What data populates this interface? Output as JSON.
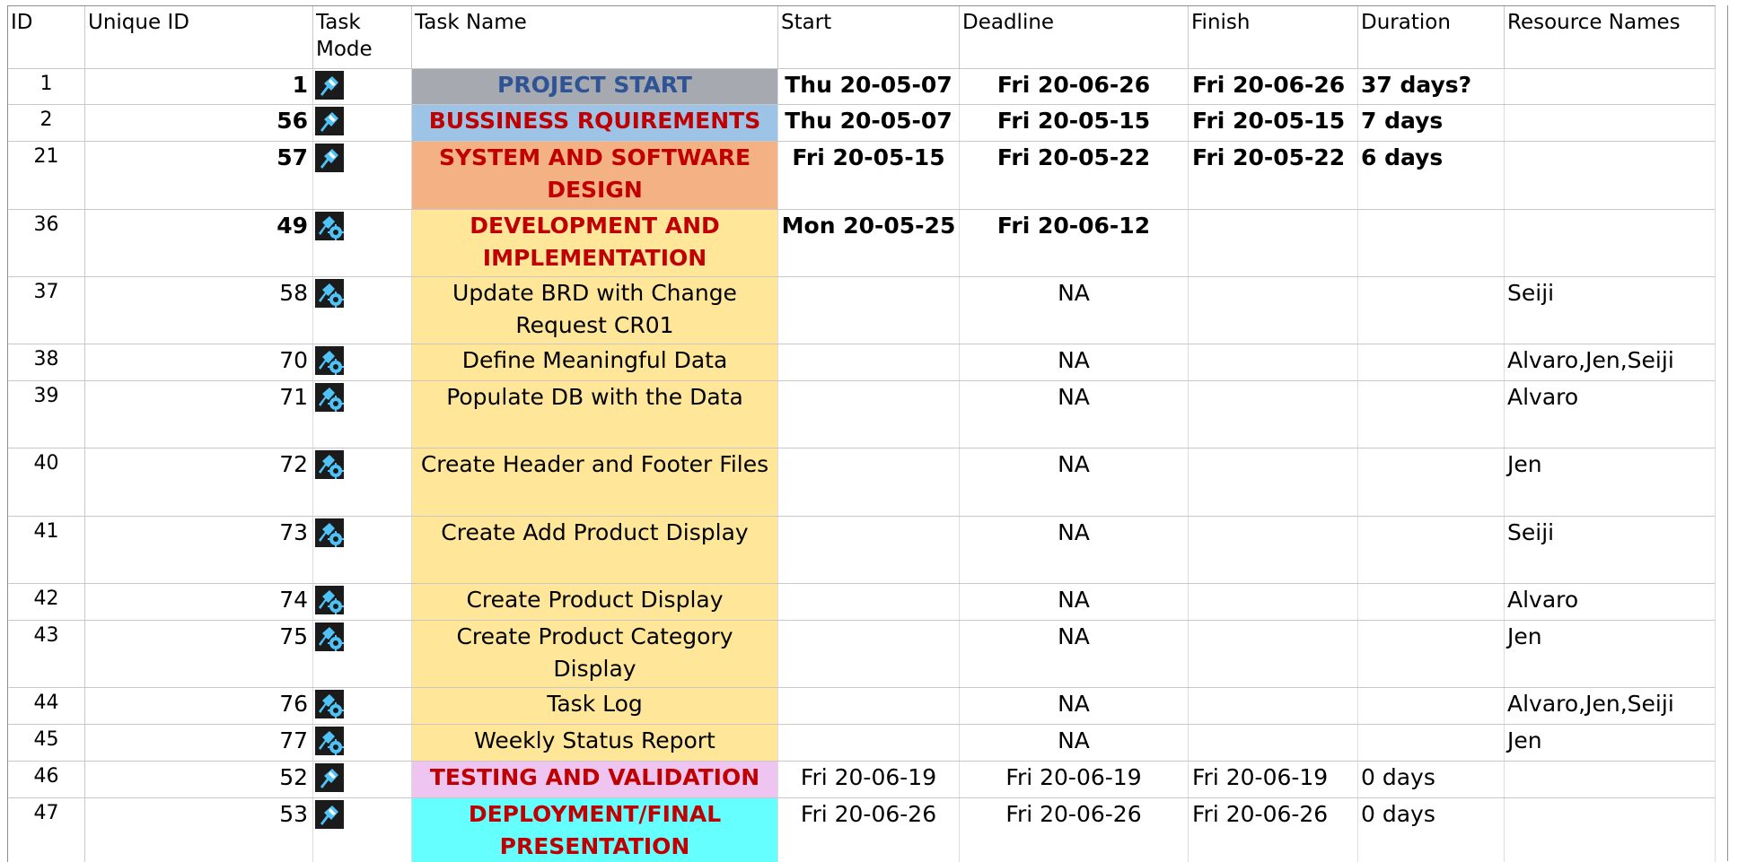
{
  "headers": {
    "id": "ID",
    "unique_id": "Unique ID",
    "task_mode": "Task Mode",
    "task_name": "Task Name",
    "start": "Start",
    "deadline": "Deadline",
    "finish": "Finish",
    "duration": "Duration",
    "resource_names": "Resource Names"
  },
  "rows": [
    {
      "id": "1",
      "uid": "1",
      "mode": "manual-pin-icon",
      "name": "PROJECT START",
      "start": "Thu 20-05-07",
      "deadline": "Fri 20-06-26",
      "finish": "Fri 20-06-26",
      "duration": "37 days?",
      "resources": "",
      "fill": "#a6a9b0",
      "name_style": "blue",
      "bold": true
    },
    {
      "id": "2",
      "uid": "56",
      "mode": "manual-pin-icon",
      "name": "BUSSINESS RQUIREMENTS",
      "start": "Thu 20-05-07",
      "deadline": "Fri 20-05-15",
      "finish": "Fri 20-05-15",
      "duration": "7 days",
      "resources": "",
      "fill": "#9dc3e6",
      "name_style": "red",
      "bold": true
    },
    {
      "id": "21",
      "uid": "57",
      "mode": "manual-pin-icon",
      "name": "SYSTEM AND SOFTWARE DESIGN",
      "start": "Fri 20-05-15",
      "deadline": "Fri 20-05-22",
      "finish": "Fri 20-05-22",
      "duration": "6 days",
      "resources": "",
      "fill": "#f4b183",
      "name_style": "red",
      "bold": true
    },
    {
      "id": "36",
      "uid": "49",
      "mode": "auto-pin-icon",
      "name": "DEVELOPMENT AND IMPLEMENTATION",
      "start": "Mon 20-05-25",
      "deadline": "Fri 20-06-12",
      "finish": "",
      "duration": "",
      "resources": "",
      "fill": "#ffe699",
      "name_style": "red",
      "bold": true
    },
    {
      "id": "37",
      "uid": "58",
      "mode": "auto-pin-icon",
      "name": "Update BRD with Change Request CR01",
      "start": "",
      "deadline": "NA",
      "finish": "",
      "duration": "",
      "resources": "Seiji",
      "fill": "#ffe699",
      "name_style": "normal",
      "bold": false
    },
    {
      "id": "38",
      "uid": "70",
      "mode": "auto-pin-icon",
      "name": "Define Meaningful Data",
      "start": "",
      "deadline": "NA",
      "finish": "",
      "duration": "",
      "resources": "Alvaro,Jen,Seiji",
      "fill": "#ffe699",
      "name_style": "normal",
      "bold": false
    },
    {
      "id": "39",
      "uid": "71",
      "mode": "auto-pin-icon",
      "name": "Populate DB with the Data",
      "start": "",
      "deadline": "NA",
      "finish": "",
      "duration": "",
      "resources": "Alvaro",
      "fill": "#ffe699",
      "name_style": "normal",
      "bold": false
    },
    {
      "id": "40",
      "uid": "72",
      "mode": "auto-pin-icon",
      "name": "Create Header and Footer Files",
      "start": "",
      "deadline": "NA",
      "finish": "",
      "duration": "",
      "resources": "Jen",
      "fill": "#ffe699",
      "name_style": "normal",
      "bold": false
    },
    {
      "id": "41",
      "uid": "73",
      "mode": "auto-pin-icon",
      "name": "Create Add Product Display",
      "start": "",
      "deadline": "NA",
      "finish": "",
      "duration": "",
      "resources": "Seiji",
      "fill": "#ffe699",
      "name_style": "normal",
      "bold": false
    },
    {
      "id": "42",
      "uid": "74",
      "mode": "auto-pin-icon",
      "name": "Create Product Display",
      "start": "",
      "deadline": "NA",
      "finish": "",
      "duration": "",
      "resources": "Alvaro",
      "fill": "#ffe699",
      "name_style": "normal",
      "bold": false
    },
    {
      "id": "43",
      "uid": "75",
      "mode": "auto-pin-icon",
      "name": "Create Product Category Display",
      "start": "",
      "deadline": "NA",
      "finish": "",
      "duration": "",
      "resources": "Jen",
      "fill": "#ffe699",
      "name_style": "normal",
      "bold": false
    },
    {
      "id": "44",
      "uid": "76",
      "mode": "auto-pin-icon",
      "name": "Task Log",
      "start": "",
      "deadline": "NA",
      "finish": "",
      "duration": "",
      "resources": "Alvaro,Jen,Seiji",
      "fill": "#ffe699",
      "name_style": "normal",
      "bold": false
    },
    {
      "id": "45",
      "uid": "77",
      "mode": "auto-pin-icon",
      "name": "Weekly Status Report",
      "start": "",
      "deadline": "NA",
      "finish": "",
      "duration": "",
      "resources": "Jen",
      "fill": "#ffe699",
      "name_style": "normal",
      "bold": false
    },
    {
      "id": "46",
      "uid": "52",
      "mode": "manual-pin-icon",
      "name": "TESTING AND VALIDATION",
      "start": "Fri 20-06-19",
      "deadline": "Fri 20-06-19",
      "finish": "Fri 20-06-19",
      "duration": "0 days",
      "resources": "",
      "fill": "#eec5f0",
      "name_style": "red",
      "bold": false
    },
    {
      "id": "47",
      "uid": "53",
      "mode": "manual-pin-icon",
      "name": "DEPLOYMENT/FINAL PRESENTATION",
      "start": "Fri 20-06-26",
      "deadline": "Fri 20-06-26",
      "finish": "Fri 20-06-26",
      "duration": "0 days",
      "resources": "",
      "fill": "#66ffff",
      "name_style": "red",
      "bold": false
    }
  ]
}
